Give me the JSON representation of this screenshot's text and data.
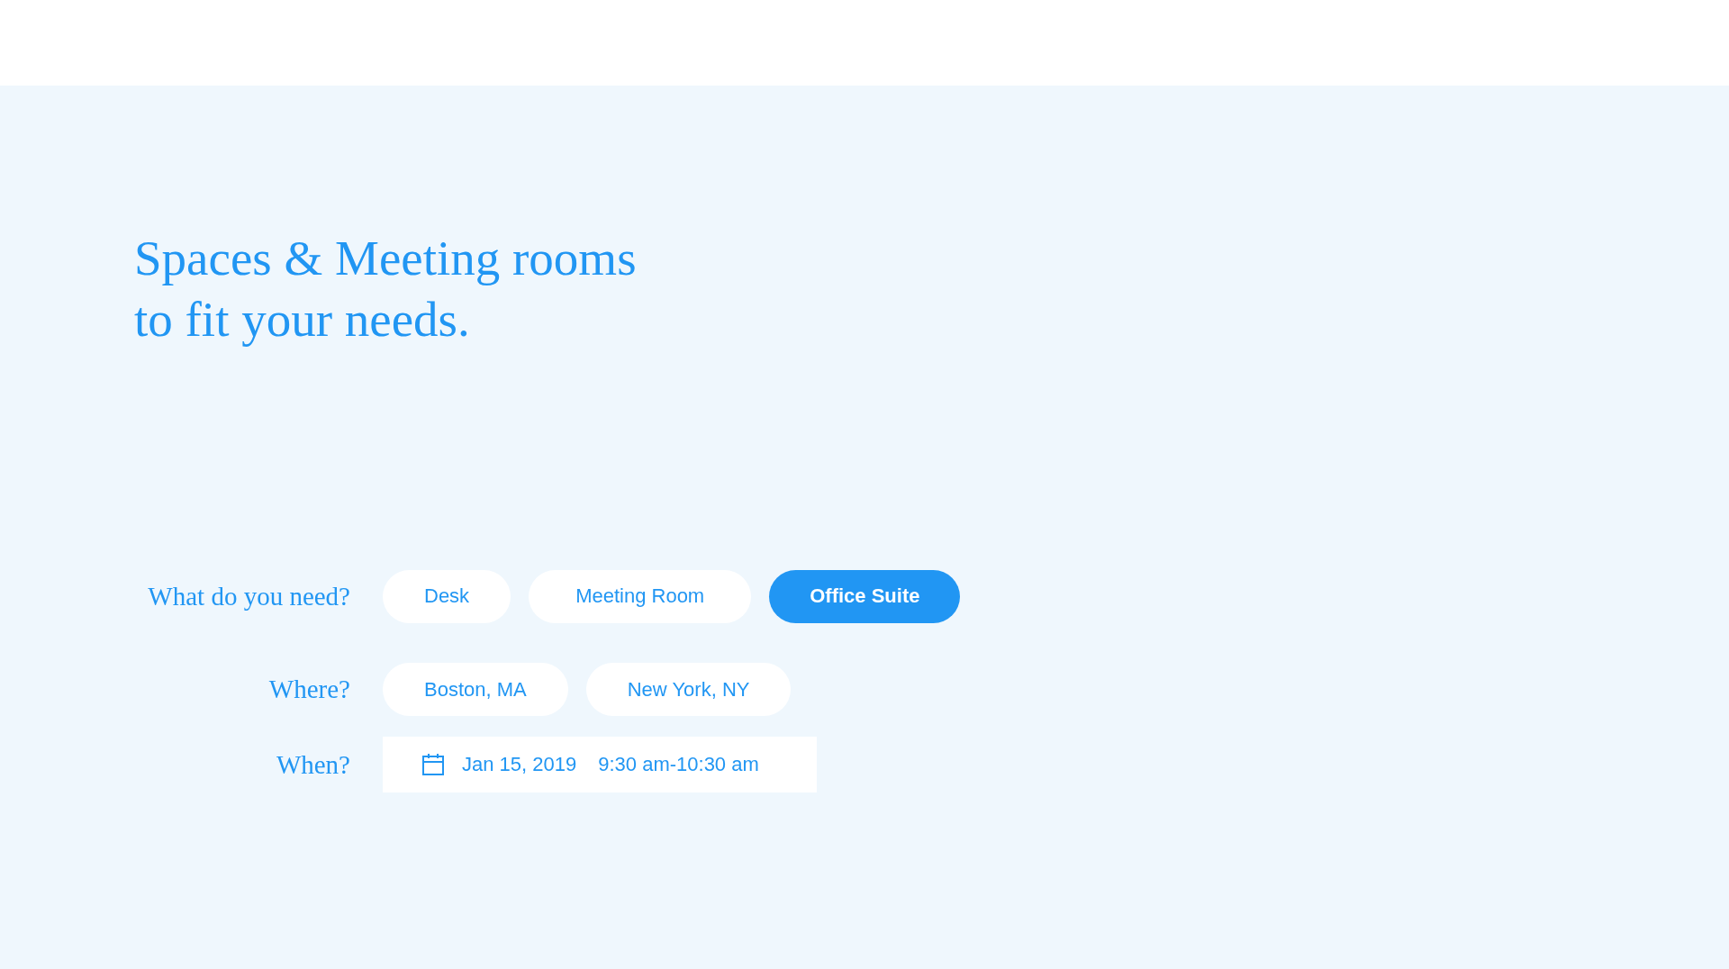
{
  "headline_lines": [
    "Spaces & Meeting rooms",
    "to fit your needs."
  ],
  "form": [
    {
      "kind": "choices",
      "label": "What do you need?",
      "options": [
        {
          "label": "Desk",
          "selected": false
        },
        {
          "label": "Meeting Room",
          "selected": false
        },
        {
          "label": "Office Suite",
          "selected": true
        }
      ]
    },
    {
      "kind": "choices",
      "label": "Where?",
      "options": [
        {
          "label": "Boston, MA",
          "selected": false
        },
        {
          "label": "New York, NY",
          "selected": false
        }
      ]
    },
    {
      "kind": "datetime",
      "label": "When?",
      "date": "Jan 15, 2019",
      "time": "9:30 am-10:30 am"
    }
  ]
}
